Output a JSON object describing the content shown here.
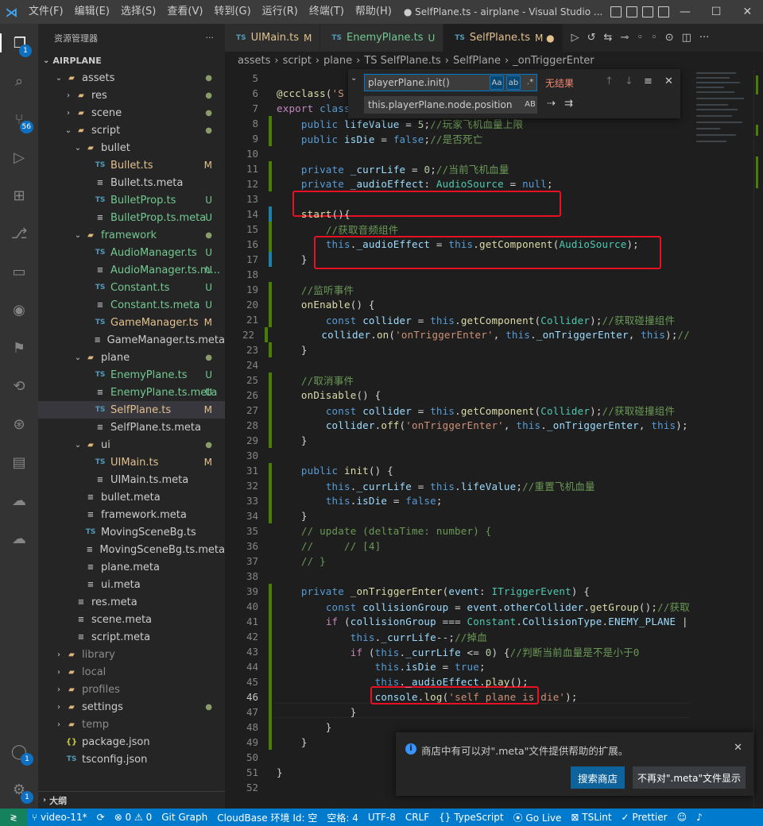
{
  "titlebar": {
    "logo": "⋊",
    "menus": [
      "文件(F)",
      "编辑(E)",
      "选择(S)",
      "查看(V)",
      "转到(G)",
      "运行(R)",
      "终端(T)",
      "帮助(H)"
    ],
    "title": "● SelfPlane.ts - airplane - Visual Studio ..."
  },
  "activity_badges": {
    "explorer": "1",
    "scm": "56",
    "account": "1",
    "manage": "1"
  },
  "sidebar": {
    "header": "资源管理器",
    "more": "···",
    "root": "AIRPLANE",
    "outline": "大纲",
    "tree": [
      {
        "name": "assets",
        "cls": "name-plain",
        "indent": 1,
        "twistie": "⌄",
        "icon": "folder",
        "deco": "●",
        "deco_cls": "dot"
      },
      {
        "name": "res",
        "cls": "name-plain",
        "indent": 2,
        "twistie": "›",
        "icon": "folder",
        "deco": "●",
        "deco_cls": "dot"
      },
      {
        "name": "scene",
        "cls": "name-plain",
        "indent": 2,
        "twistie": "›",
        "icon": "folder",
        "deco": "●",
        "deco_cls": "dot"
      },
      {
        "name": "script",
        "cls": "name-plain",
        "indent": 2,
        "twistie": "⌄",
        "icon": "folder",
        "deco": "●",
        "deco_cls": "dot"
      },
      {
        "name": "bullet",
        "cls": "name-plain",
        "indent": 3,
        "twistie": "⌄",
        "icon": "folder",
        "deco": "",
        "deco_cls": ""
      },
      {
        "name": "Bullet.ts",
        "cls": "name-m",
        "indent": 4,
        "twistie": "",
        "icon": "ts",
        "deco": "M",
        "deco_cls": "m"
      },
      {
        "name": "Bullet.ts.meta",
        "cls": "name-plain",
        "indent": 4,
        "twistie": "",
        "icon": "meta",
        "deco": "",
        "deco_cls": ""
      },
      {
        "name": "BulletProp.ts",
        "cls": "name-u",
        "indent": 4,
        "twistie": "",
        "icon": "ts",
        "deco": "U",
        "deco_cls": "u"
      },
      {
        "name": "BulletProp.ts.meta",
        "cls": "name-u",
        "indent": 4,
        "twistie": "",
        "icon": "meta",
        "deco": "U",
        "deco_cls": "u"
      },
      {
        "name": "framework",
        "cls": "name-u",
        "indent": 3,
        "twistie": "⌄",
        "icon": "folder",
        "deco": "●",
        "deco_cls": "dot"
      },
      {
        "name": "AudioManager.ts",
        "cls": "name-u",
        "indent": 4,
        "twistie": "",
        "icon": "ts",
        "deco": "U",
        "deco_cls": "u"
      },
      {
        "name": "AudioManager.ts.m...",
        "cls": "name-u",
        "indent": 4,
        "twistie": "",
        "icon": "meta",
        "deco": "U",
        "deco_cls": "u"
      },
      {
        "name": "Constant.ts",
        "cls": "name-u",
        "indent": 4,
        "twistie": "",
        "icon": "ts",
        "deco": "U",
        "deco_cls": "u"
      },
      {
        "name": "Constant.ts.meta",
        "cls": "name-u",
        "indent": 4,
        "twistie": "",
        "icon": "meta",
        "deco": "U",
        "deco_cls": "u"
      },
      {
        "name": "GameManager.ts",
        "cls": "name-m",
        "indent": 4,
        "twistie": "",
        "icon": "ts",
        "deco": "M",
        "deco_cls": "m"
      },
      {
        "name": "GameManager.ts.meta",
        "cls": "name-plain",
        "indent": 4,
        "twistie": "",
        "icon": "meta",
        "deco": "",
        "deco_cls": ""
      },
      {
        "name": "plane",
        "cls": "name-plain",
        "indent": 3,
        "twistie": "⌄",
        "icon": "folder",
        "deco": "●",
        "deco_cls": "dot"
      },
      {
        "name": "EnemyPlane.ts",
        "cls": "name-u",
        "indent": 4,
        "twistie": "",
        "icon": "ts",
        "deco": "U",
        "deco_cls": "u"
      },
      {
        "name": "EnemyPlane.ts.meta",
        "cls": "name-u",
        "indent": 4,
        "twistie": "",
        "icon": "meta",
        "deco": "U",
        "deco_cls": "u"
      },
      {
        "name": "SelfPlane.ts",
        "cls": "name-m",
        "indent": 4,
        "twistie": "",
        "icon": "ts",
        "deco": "M",
        "deco_cls": "m",
        "selected": true
      },
      {
        "name": "SelfPlane.ts.meta",
        "cls": "name-plain",
        "indent": 4,
        "twistie": "",
        "icon": "meta",
        "deco": "",
        "deco_cls": ""
      },
      {
        "name": "ui",
        "cls": "name-plain",
        "indent": 3,
        "twistie": "⌄",
        "icon": "folder",
        "deco": "●",
        "deco_cls": "dot"
      },
      {
        "name": "UIMain.ts",
        "cls": "name-m",
        "indent": 4,
        "twistie": "",
        "icon": "ts",
        "deco": "M",
        "deco_cls": "m"
      },
      {
        "name": "UIMain.ts.meta",
        "cls": "name-plain",
        "indent": 4,
        "twistie": "",
        "icon": "meta",
        "deco": "",
        "deco_cls": ""
      },
      {
        "name": "bullet.meta",
        "cls": "name-plain",
        "indent": 3,
        "twistie": "",
        "icon": "meta",
        "deco": "",
        "deco_cls": ""
      },
      {
        "name": "framework.meta",
        "cls": "name-plain",
        "indent": 3,
        "twistie": "",
        "icon": "meta",
        "deco": "",
        "deco_cls": ""
      },
      {
        "name": "MovingSceneBg.ts",
        "cls": "name-plain",
        "indent": 3,
        "twistie": "",
        "icon": "ts",
        "deco": "",
        "deco_cls": ""
      },
      {
        "name": "MovingSceneBg.ts.meta",
        "cls": "name-plain",
        "indent": 3,
        "twistie": "",
        "icon": "meta",
        "deco": "",
        "deco_cls": ""
      },
      {
        "name": "plane.meta",
        "cls": "name-plain",
        "indent": 3,
        "twistie": "",
        "icon": "meta",
        "deco": "",
        "deco_cls": ""
      },
      {
        "name": "ui.meta",
        "cls": "name-plain",
        "indent": 3,
        "twistie": "",
        "icon": "meta",
        "deco": "",
        "deco_cls": ""
      },
      {
        "name": "res.meta",
        "cls": "name-plain",
        "indent": 2,
        "twistie": "",
        "icon": "meta",
        "deco": "",
        "deco_cls": ""
      },
      {
        "name": "scene.meta",
        "cls": "name-plain",
        "indent": 2,
        "twistie": "",
        "icon": "meta",
        "deco": "",
        "deco_cls": ""
      },
      {
        "name": "script.meta",
        "cls": "name-plain",
        "indent": 2,
        "twistie": "",
        "icon": "meta",
        "deco": "",
        "deco_cls": ""
      },
      {
        "name": "library",
        "cls": "name-ignored",
        "indent": 1,
        "twistie": "›",
        "icon": "folder",
        "deco": "",
        "deco_cls": ""
      },
      {
        "name": "local",
        "cls": "name-ignored",
        "indent": 1,
        "twistie": "›",
        "icon": "folder",
        "deco": "",
        "deco_cls": ""
      },
      {
        "name": "profiles",
        "cls": "name-ignored",
        "indent": 1,
        "twistie": "›",
        "icon": "folder",
        "deco": "",
        "deco_cls": ""
      },
      {
        "name": "settings",
        "cls": "name-plain",
        "indent": 1,
        "twistie": "›",
        "icon": "folder",
        "deco": "●",
        "deco_cls": "dot"
      },
      {
        "name": "temp",
        "cls": "name-ignored",
        "indent": 1,
        "twistie": "›",
        "icon": "folder",
        "deco": "",
        "deco_cls": ""
      },
      {
        "name": "package.json",
        "cls": "name-plain",
        "indent": 1,
        "twistie": "",
        "icon": "json",
        "deco": "",
        "deco_cls": ""
      },
      {
        "name": "tsconfig.json",
        "cls": "name-plain",
        "indent": 1,
        "twistie": "",
        "icon": "ts",
        "deco": "",
        "deco_cls": ""
      }
    ]
  },
  "tabs": [
    {
      "label": "UIMain.ts",
      "status": "M",
      "status_cls": "",
      "active": false
    },
    {
      "label": "EnemyPlane.ts",
      "status": "U",
      "status_cls": "u",
      "active": false
    },
    {
      "label": "SelfPlane.ts",
      "status": "M ●",
      "status_cls": "",
      "active": true
    }
  ],
  "breadcrumb": [
    "assets",
    "script",
    "plane",
    "TS SelfPlane.ts",
    "SelfPlane",
    "_onTriggerEnter"
  ],
  "find": {
    "query": "playerPlane.init()",
    "replace": "this.playerPlane.node.position",
    "result": "无结果",
    "opt_case": "Aa",
    "opt_word": "ab",
    "opt_regex": ".*",
    "opt_preserve": "AB"
  },
  "code_lines": [
    {
      "n": "5",
      "html": "",
      "mark": ""
    },
    {
      "n": "6",
      "html": "<span class='fn'>@ccclass</span>(<span class='str'>'S</span>",
      "mark": ""
    },
    {
      "n": "7",
      "html": "<span class='kw2'>export</span> <span class='kw'>class</span> <span class='cls'>SelfPlane</span> <span class='kw'>extends</span> <span class='cls'>Component</span> {",
      "mark": ""
    },
    {
      "n": "8",
      "html": "    <span class='kw'>public</span> <span class='var'>lifeValue</span> = <span class='num'>5</span>;<span class='cmt'>//玩家飞机血量上限</span>",
      "mark": "add"
    },
    {
      "n": "9",
      "html": "    <span class='kw'>public</span> <span class='var'>isDie</span> = <span class='kw'>false</span>;<span class='cmt'>//是否死亡</span>",
      "mark": "add"
    },
    {
      "n": "10",
      "html": "",
      "mark": ""
    },
    {
      "n": "11",
      "html": "    <span class='kw'>private</span> <span class='var'>_currLife</span> = <span class='num'>0</span>;<span class='cmt'>//当前飞机血量</span>",
      "mark": "add"
    },
    {
      "n": "12",
      "html": "    <span class='kw'>private</span> <span class='var'>_audioEffect</span>: <span class='cls'>AudioSource</span> = <span class='kw'>null</span>;",
      "mark": "add"
    },
    {
      "n": "13",
      "html": "",
      "mark": ""
    },
    {
      "n": "14",
      "html": "    <span class='fn'>start</span>(){",
      "mark": "mod"
    },
    {
      "n": "15",
      "html": "        <span class='cmt'>//获取音频组件</span>",
      "mark": "add"
    },
    {
      "n": "16",
      "html": "        <span class='kw'>this</span>.<span class='var'>_audioEffect</span> = <span class='kw'>this</span>.<span class='fn'>getComponent</span>(<span class='cls'>AudioSource</span>);",
      "mark": "add"
    },
    {
      "n": "17",
      "html": "    }",
      "mark": "mod"
    },
    {
      "n": "18",
      "html": "",
      "mark": ""
    },
    {
      "n": "19",
      "html": "    <span class='cmt'>//监听事件</span>",
      "mark": "add"
    },
    {
      "n": "20",
      "html": "    <span class='fn'>onEnable</span>() {",
      "mark": "add"
    },
    {
      "n": "21",
      "html": "        <span class='kw'>const</span> <span class='var'>collider</span> = <span class='kw'>this</span>.<span class='fn'>getComponent</span>(<span class='cls'>Collider</span>);<span class='cmt'>//获取碰撞组件</span>",
      "mark": "add"
    },
    {
      "n": "22",
      "html": "        <span class='var'>collider</span>.<span class='fn'>on</span>(<span class='str'>'onTriggerEnter'</span>, <span class='kw'>this</span>.<span class='var'>_onTriggerEnter</span>, <span class='kw'>this</span>);<span class='cmt'>//</span>",
      "mark": "add"
    },
    {
      "n": "23",
      "html": "    }",
      "mark": "add"
    },
    {
      "n": "24",
      "html": "",
      "mark": ""
    },
    {
      "n": "25",
      "html": "    <span class='cmt'>//取消事件</span>",
      "mark": "add"
    },
    {
      "n": "26",
      "html": "    <span class='fn'>onDisable</span>() {",
      "mark": "add"
    },
    {
      "n": "27",
      "html": "        <span class='kw'>const</span> <span class='var'>collider</span> = <span class='kw'>this</span>.<span class='fn'>getComponent</span>(<span class='cls'>Collider</span>);<span class='cmt'>//获取碰撞组件</span>",
      "mark": "add"
    },
    {
      "n": "28",
      "html": "        <span class='var'>collider</span>.<span class='fn'>off</span>(<span class='str'>'onTriggerEnter'</span>, <span class='kw'>this</span>.<span class='var'>_onTriggerEnter</span>, <span class='kw'>this</span>);",
      "mark": "add"
    },
    {
      "n": "29",
      "html": "    }",
      "mark": "add"
    },
    {
      "n": "30",
      "html": "",
      "mark": ""
    },
    {
      "n": "31",
      "html": "    <span class='kw'>public</span> <span class='fn'>init</span>() {",
      "mark": "add"
    },
    {
      "n": "32",
      "html": "        <span class='kw'>this</span>.<span class='var'>_currLife</span> = <span class='kw'>this</span>.<span class='var'>lifeValue</span>;<span class='cmt'>//重置飞机血量</span>",
      "mark": "add"
    },
    {
      "n": "33",
      "html": "        <span class='kw'>this</span>.<span class='var'>isDie</span> = <span class='kw'>false</span>;",
      "mark": "add"
    },
    {
      "n": "34",
      "html": "    }",
      "mark": "add"
    },
    {
      "n": "35",
      "html": "    <span class='cmt'>// update (deltaTime: number) {</span>",
      "mark": ""
    },
    {
      "n": "36",
      "html": "    <span class='cmt'>//     // [4]</span>",
      "mark": ""
    },
    {
      "n": "37",
      "html": "    <span class='cmt'>// }</span>",
      "mark": ""
    },
    {
      "n": "38",
      "html": "",
      "mark": ""
    },
    {
      "n": "39",
      "html": "    <span class='kw'>private</span> <span class='fn'>_onTriggerEnter</span>(<span class='var'>event</span>: <span class='cls'>ITriggerEvent</span>) {",
      "mark": "add"
    },
    {
      "n": "40",
      "html": "        <span class='kw'>const</span> <span class='var'>collisionGroup</span> = <span class='var'>event</span>.<span class='var'>otherCollider</span>.<span class='fn'>getGroup</span>();<span class='cmt'>//获取</span>",
      "mark": "add"
    },
    {
      "n": "41",
      "html": "        <span class='kw2'>if</span> (<span class='var'>collisionGroup</span> === <span class='cls'>Constant</span>.<span class='var'>CollisionType</span>.<span class='var'>ENEMY_PLANE</span> |",
      "mark": "add"
    },
    {
      "n": "42",
      "html": "            <span class='kw'>this</span>.<span class='var'>_currLife</span>--;<span class='cmt'>//掉血</span>",
      "mark": "add"
    },
    {
      "n": "43",
      "html": "            <span class='kw2'>if</span> (<span class='kw'>this</span>.<span class='var'>_currLife</span> &lt;= <span class='num'>0</span>) {<span class='cmt'>//判断当前血量是不是小于0</span>",
      "mark": "add"
    },
    {
      "n": "44",
      "html": "                <span class='kw'>this</span>.<span class='var'>isDie</span> = <span class='kw'>true</span>;",
      "mark": "add"
    },
    {
      "n": "45",
      "html": "                <span class='kw'>this</span>.<span class='var'>_audioEffect</span>.<span class='fn'>play</span>();",
      "mark": "add"
    },
    {
      "n": "46",
      "html": "                <span class='var'>console</span>.<span class='fn'>log</span>(<span class='str'>'self plane is die'</span>);",
      "mark": "add",
      "current": true
    },
    {
      "n": "47",
      "html": "            }",
      "mark": "add"
    },
    {
      "n": "48",
      "html": "        }",
      "mark": "add"
    },
    {
      "n": "49",
      "html": "    }",
      "mark": "add"
    },
    {
      "n": "50",
      "html": "",
      "mark": ""
    },
    {
      "n": "51",
      "html": "}",
      "mark": ""
    },
    {
      "n": "52",
      "html": "",
      "mark": ""
    }
  ],
  "notification": {
    "message": "商店中有可以对\".meta\"文件提供帮助的扩展。",
    "primary": "搜索商店",
    "secondary": "不再对\".meta\"文件显示",
    "info_glyph": "i",
    "close": "✕"
  },
  "statusbar": {
    "remote": "≷",
    "branch": "video-11*",
    "sync": "⟳",
    "problems": "⊗ 0 ⚠ 0",
    "gitgraph": "Git Graph",
    "cloudbase": "CloudBase 环境 Id: 空",
    "spaces": "空格: 4",
    "encoding": "UTF-8",
    "eol": "CRLF",
    "language": "{} TypeScript",
    "golive": "Go Live",
    "tslint": "TSLint",
    "prettier": "✓ Prettier"
  },
  "colors": {
    "accent": "#007acc",
    "highlight": "#e81123",
    "modified": "#e2c08d",
    "untracked": "#73c991"
  }
}
